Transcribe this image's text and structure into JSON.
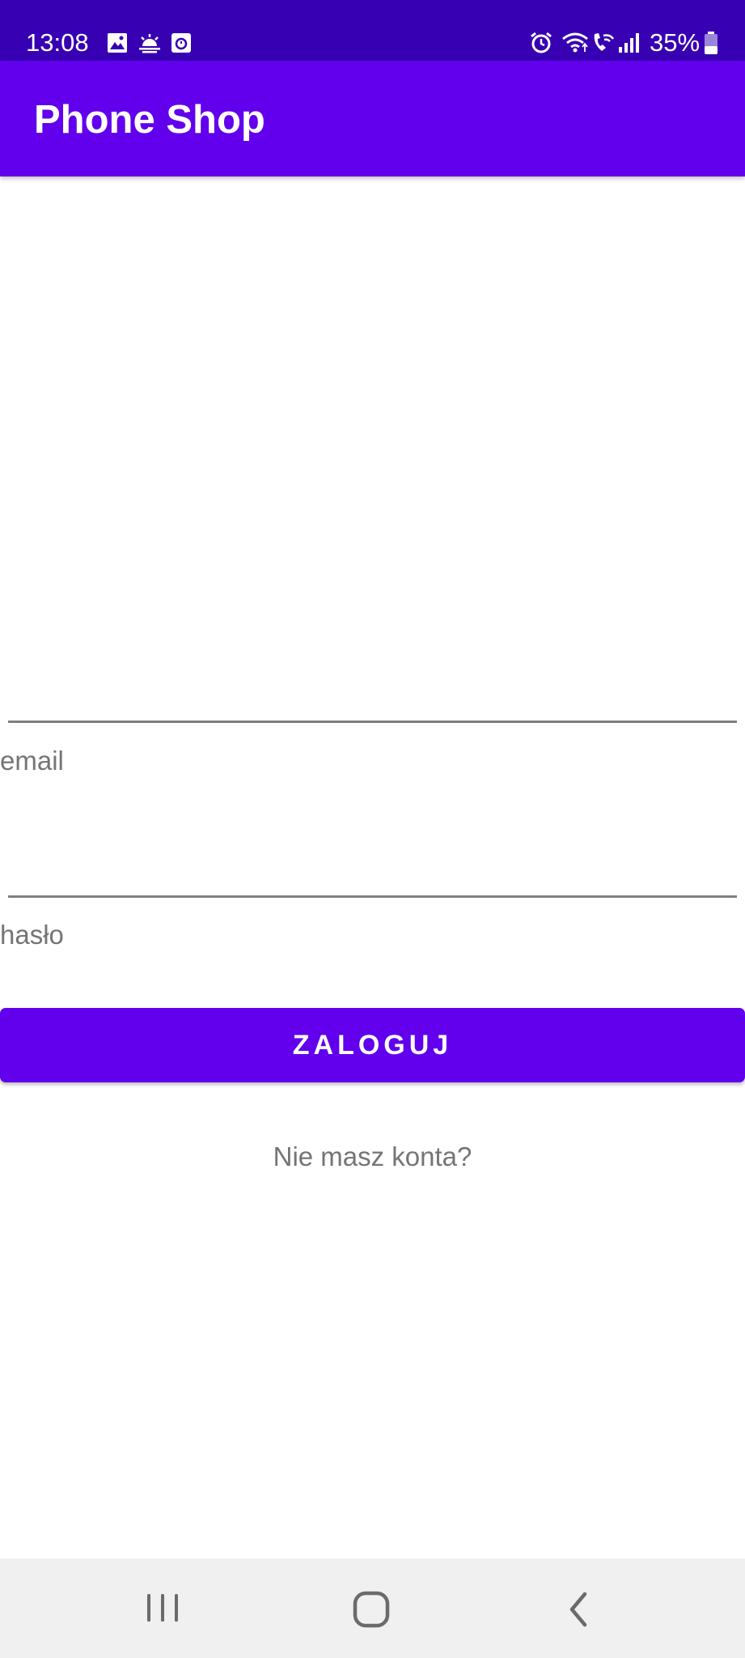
{
  "status_bar": {
    "time": "13:08",
    "battery": "35%",
    "background": "#3700B3",
    "left_icons": [
      "gallery-icon",
      "weather-icon",
      "app-notification-icon"
    ],
    "right_icons": [
      "alarm-icon",
      "wifi-icon",
      "wifi-calling-icon",
      "signal-icon",
      "battery-icon"
    ]
  },
  "app_bar": {
    "title": "Phone Shop",
    "background": "#6200EE"
  },
  "form": {
    "email_value": "",
    "email_label": "email",
    "password_value": "",
    "password_label": "hasło",
    "login_button": "ZALOGUJ",
    "register_link": "Nie masz konta?"
  },
  "nav_bar": {
    "buttons": [
      "recent-apps",
      "home",
      "back"
    ]
  }
}
